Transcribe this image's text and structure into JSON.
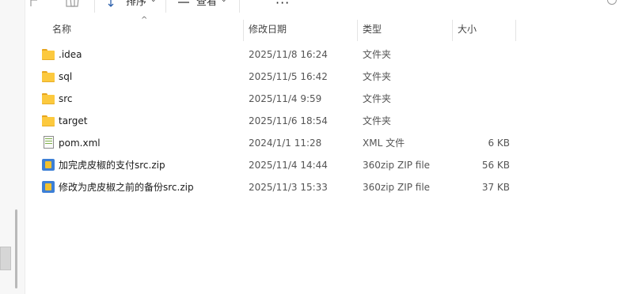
{
  "toolbar": {
    "sort_label": "排序",
    "view_label": "查看",
    "more_label": "···"
  },
  "columns": {
    "name": "名称",
    "date": "修改日期",
    "type": "类型",
    "size": "大小"
  },
  "files": [
    {
      "name": ".idea",
      "date": "2025/11/8 16:24",
      "type": "文件夹",
      "size": "",
      "icon": "folder-icon"
    },
    {
      "name": "sql",
      "date": "2025/11/5 16:42",
      "type": "文件夹",
      "size": "",
      "icon": "folder-icon"
    },
    {
      "name": "src",
      "date": "2025/11/4 9:59",
      "type": "文件夹",
      "size": "",
      "icon": "folder-icon"
    },
    {
      "name": "target",
      "date": "2025/11/6 18:54",
      "type": "文件夹",
      "size": "",
      "icon": "folder-icon"
    },
    {
      "name": "pom.xml",
      "date": "2024/1/1 11:28",
      "type": "XML 文件",
      "size": "6 KB",
      "icon": "xml-file-icon"
    },
    {
      "name": "加完虎皮椒的支付src.zip",
      "date": "2025/11/4 14:44",
      "type": "360zip ZIP file",
      "size": "56 KB",
      "icon": "zip-file-icon"
    },
    {
      "name": "修改为虎皮椒之前的备份src.zip",
      "date": "2025/11/3 15:33",
      "type": "360zip ZIP file",
      "size": "37 KB",
      "icon": "zip-file-icon"
    }
  ]
}
